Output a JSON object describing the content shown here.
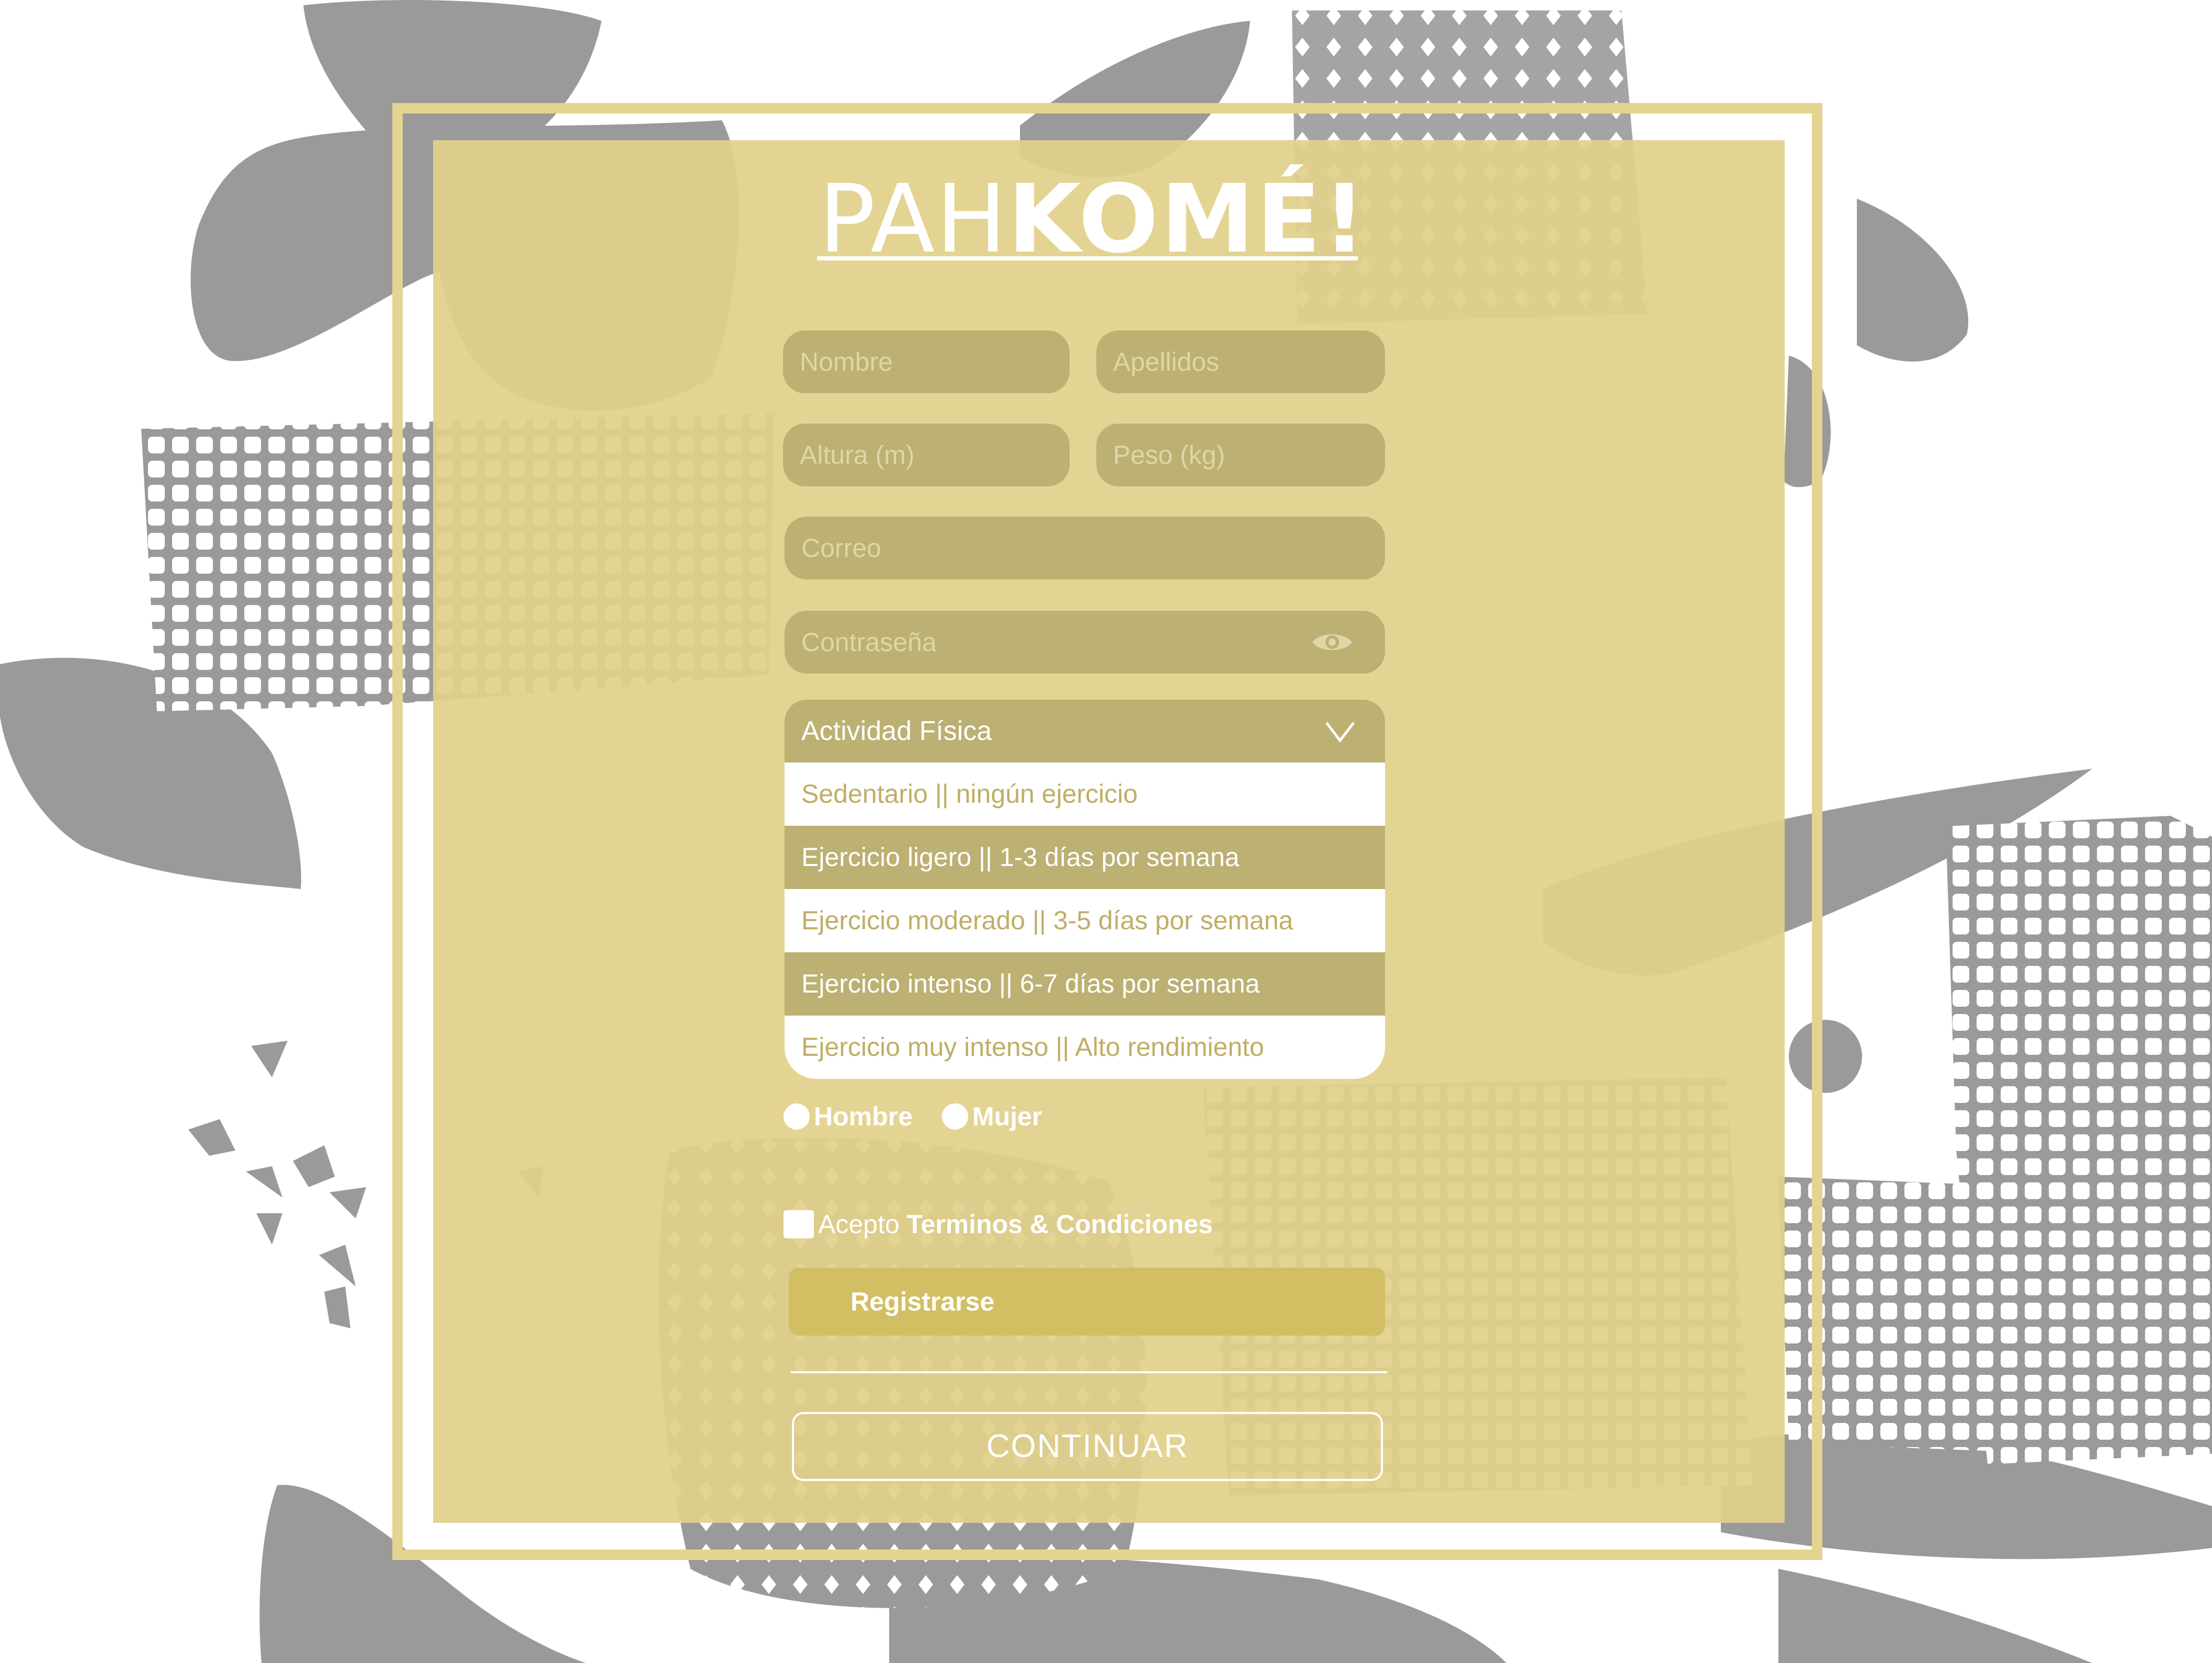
{
  "logo": {
    "light": "PAH",
    "bold": "KOMÉ!"
  },
  "form": {
    "nombre_placeholder": "Nombre",
    "apellidos_placeholder": "Apellidos",
    "altura_placeholder": "Altura (m)",
    "peso_placeholder": "Peso (kg)",
    "correo_placeholder": "Correo",
    "contrasena_placeholder": "Contraseña"
  },
  "activity": {
    "label": "Actividad Física",
    "options": [
      "Sedentario || ningún ejercicio",
      "Ejercicio ligero || 1-3 días por semana",
      "Ejercicio moderado || 3-5 días por semana",
      "Ejercicio intenso || 6-7 días por semana",
      "Ejercicio muy intenso || Alto rendimiento"
    ]
  },
  "gender": {
    "male": "Hombre",
    "female": "Mujer"
  },
  "terms": {
    "prefix": "Acepto",
    "link": "Terminos & Condiciones"
  },
  "buttons": {
    "register": "Registrarse",
    "continue": "CONTINUAR"
  },
  "colors": {
    "panel": "#e2d18b",
    "field": "#bcb073",
    "accent": "#d2bf63",
    "background_shapes": "#9a9a9a"
  }
}
